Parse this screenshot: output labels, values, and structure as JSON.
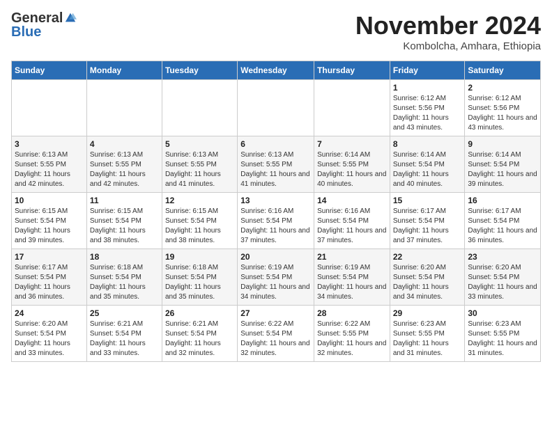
{
  "logo": {
    "general": "General",
    "blue": "Blue"
  },
  "title": {
    "month_year": "November 2024",
    "location": "Kombolcha, Amhara, Ethiopia"
  },
  "days_of_week": [
    "Sunday",
    "Monday",
    "Tuesday",
    "Wednesday",
    "Thursday",
    "Friday",
    "Saturday"
  ],
  "weeks": [
    [
      {
        "day": "",
        "info": ""
      },
      {
        "day": "",
        "info": ""
      },
      {
        "day": "",
        "info": ""
      },
      {
        "day": "",
        "info": ""
      },
      {
        "day": "",
        "info": ""
      },
      {
        "day": "1",
        "info": "Sunrise: 6:12 AM\nSunset: 5:56 PM\nDaylight: 11 hours and 43 minutes."
      },
      {
        "day": "2",
        "info": "Sunrise: 6:12 AM\nSunset: 5:56 PM\nDaylight: 11 hours and 43 minutes."
      }
    ],
    [
      {
        "day": "3",
        "info": "Sunrise: 6:13 AM\nSunset: 5:55 PM\nDaylight: 11 hours and 42 minutes."
      },
      {
        "day": "4",
        "info": "Sunrise: 6:13 AM\nSunset: 5:55 PM\nDaylight: 11 hours and 42 minutes."
      },
      {
        "day": "5",
        "info": "Sunrise: 6:13 AM\nSunset: 5:55 PM\nDaylight: 11 hours and 41 minutes."
      },
      {
        "day": "6",
        "info": "Sunrise: 6:13 AM\nSunset: 5:55 PM\nDaylight: 11 hours and 41 minutes."
      },
      {
        "day": "7",
        "info": "Sunrise: 6:14 AM\nSunset: 5:55 PM\nDaylight: 11 hours and 40 minutes."
      },
      {
        "day": "8",
        "info": "Sunrise: 6:14 AM\nSunset: 5:54 PM\nDaylight: 11 hours and 40 minutes."
      },
      {
        "day": "9",
        "info": "Sunrise: 6:14 AM\nSunset: 5:54 PM\nDaylight: 11 hours and 39 minutes."
      }
    ],
    [
      {
        "day": "10",
        "info": "Sunrise: 6:15 AM\nSunset: 5:54 PM\nDaylight: 11 hours and 39 minutes."
      },
      {
        "day": "11",
        "info": "Sunrise: 6:15 AM\nSunset: 5:54 PM\nDaylight: 11 hours and 38 minutes."
      },
      {
        "day": "12",
        "info": "Sunrise: 6:15 AM\nSunset: 5:54 PM\nDaylight: 11 hours and 38 minutes."
      },
      {
        "day": "13",
        "info": "Sunrise: 6:16 AM\nSunset: 5:54 PM\nDaylight: 11 hours and 37 minutes."
      },
      {
        "day": "14",
        "info": "Sunrise: 6:16 AM\nSunset: 5:54 PM\nDaylight: 11 hours and 37 minutes."
      },
      {
        "day": "15",
        "info": "Sunrise: 6:17 AM\nSunset: 5:54 PM\nDaylight: 11 hours and 37 minutes."
      },
      {
        "day": "16",
        "info": "Sunrise: 6:17 AM\nSunset: 5:54 PM\nDaylight: 11 hours and 36 minutes."
      }
    ],
    [
      {
        "day": "17",
        "info": "Sunrise: 6:17 AM\nSunset: 5:54 PM\nDaylight: 11 hours and 36 minutes."
      },
      {
        "day": "18",
        "info": "Sunrise: 6:18 AM\nSunset: 5:54 PM\nDaylight: 11 hours and 35 minutes."
      },
      {
        "day": "19",
        "info": "Sunrise: 6:18 AM\nSunset: 5:54 PM\nDaylight: 11 hours and 35 minutes."
      },
      {
        "day": "20",
        "info": "Sunrise: 6:19 AM\nSunset: 5:54 PM\nDaylight: 11 hours and 34 minutes."
      },
      {
        "day": "21",
        "info": "Sunrise: 6:19 AM\nSunset: 5:54 PM\nDaylight: 11 hours and 34 minutes."
      },
      {
        "day": "22",
        "info": "Sunrise: 6:20 AM\nSunset: 5:54 PM\nDaylight: 11 hours and 34 minutes."
      },
      {
        "day": "23",
        "info": "Sunrise: 6:20 AM\nSunset: 5:54 PM\nDaylight: 11 hours and 33 minutes."
      }
    ],
    [
      {
        "day": "24",
        "info": "Sunrise: 6:20 AM\nSunset: 5:54 PM\nDaylight: 11 hours and 33 minutes."
      },
      {
        "day": "25",
        "info": "Sunrise: 6:21 AM\nSunset: 5:54 PM\nDaylight: 11 hours and 33 minutes."
      },
      {
        "day": "26",
        "info": "Sunrise: 6:21 AM\nSunset: 5:54 PM\nDaylight: 11 hours and 32 minutes."
      },
      {
        "day": "27",
        "info": "Sunrise: 6:22 AM\nSunset: 5:54 PM\nDaylight: 11 hours and 32 minutes."
      },
      {
        "day": "28",
        "info": "Sunrise: 6:22 AM\nSunset: 5:55 PM\nDaylight: 11 hours and 32 minutes."
      },
      {
        "day": "29",
        "info": "Sunrise: 6:23 AM\nSunset: 5:55 PM\nDaylight: 11 hours and 31 minutes."
      },
      {
        "day": "30",
        "info": "Sunrise: 6:23 AM\nSunset: 5:55 PM\nDaylight: 11 hours and 31 minutes."
      }
    ]
  ]
}
